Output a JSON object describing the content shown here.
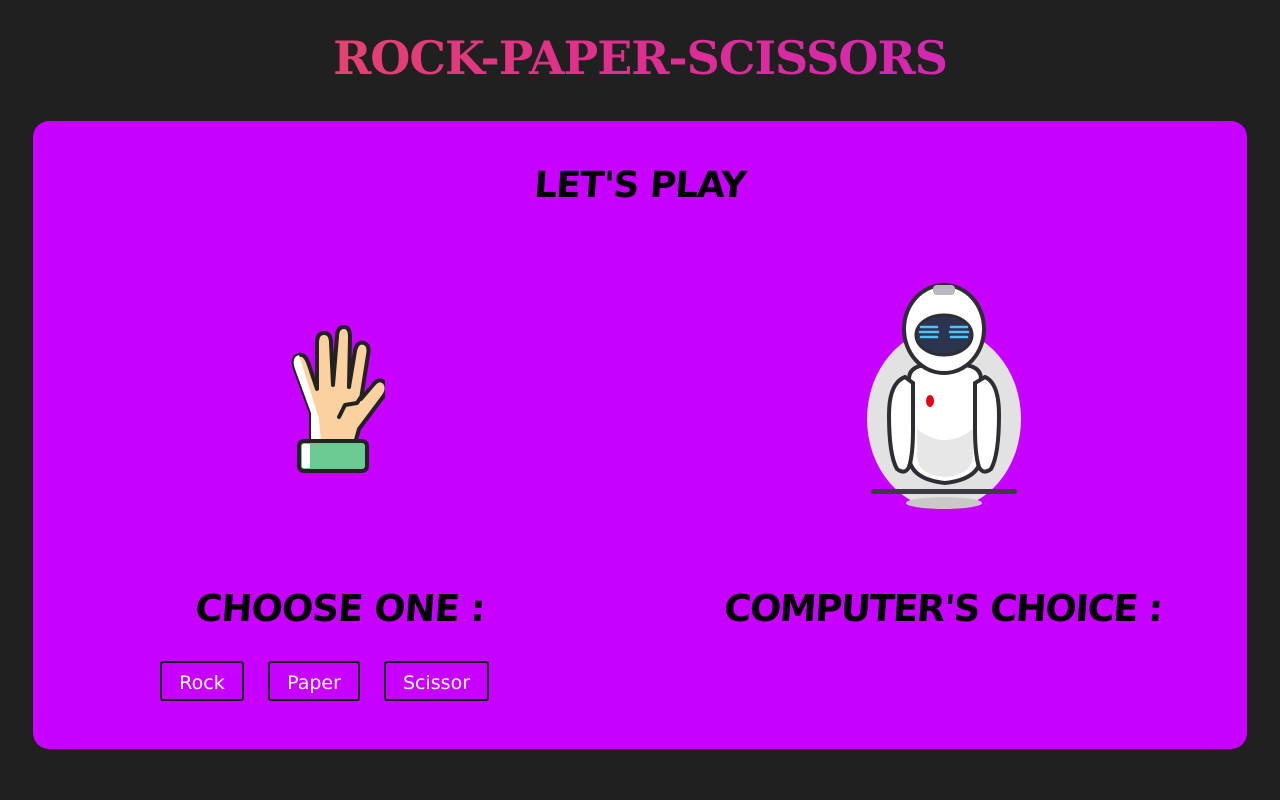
{
  "header": {
    "title": "ROCK-PAPER-SCISSORS"
  },
  "game": {
    "heading": "LET'S PLAY",
    "player_label": "CHOOSE ONE :",
    "computer_label": "COMPUTER'S CHOICE :",
    "player_icon": "hand-icon",
    "computer_icon": "robot-icon",
    "buttons": {
      "rock": "Rock",
      "paper": "Paper",
      "scissor": "Scissor"
    }
  },
  "colors": {
    "background": "#1f201f",
    "panel": "#c800ff",
    "title_gradient_start": "#ea5a4c",
    "title_gradient_end": "#c81fd8"
  }
}
